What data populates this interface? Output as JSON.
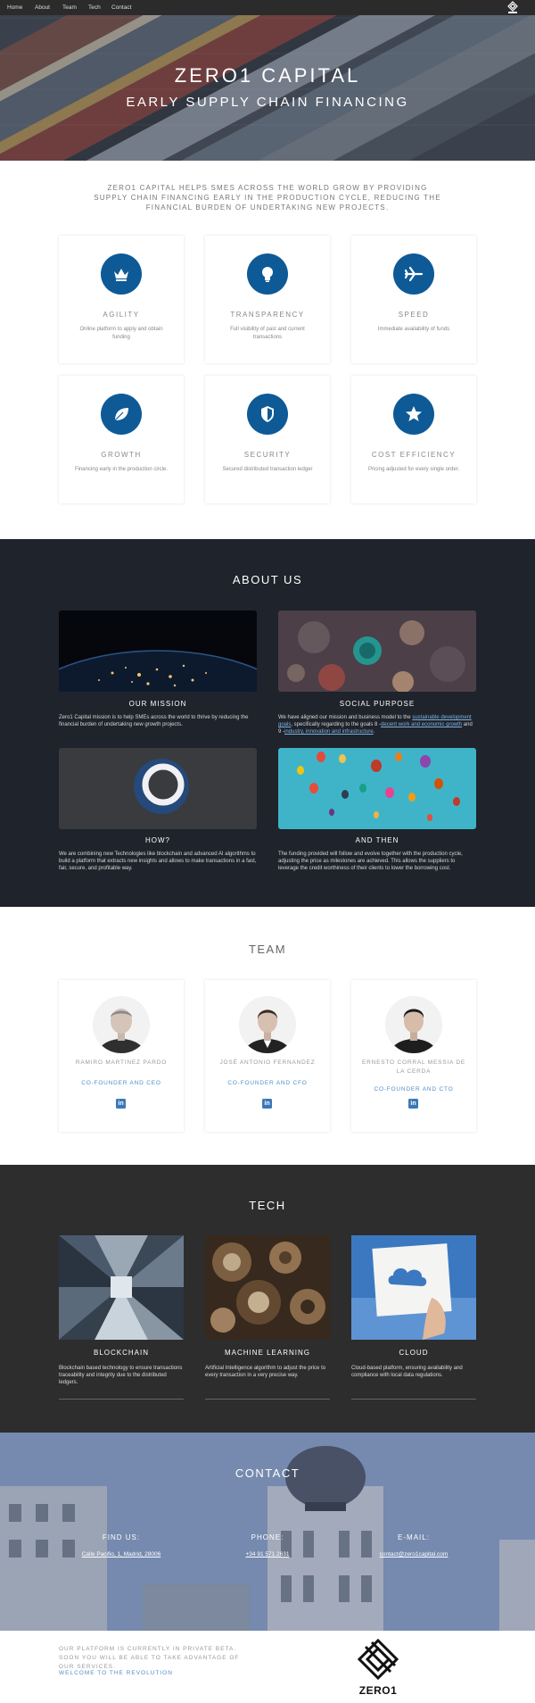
{
  "nav": {
    "links": [
      "Home",
      "About",
      "Team",
      "Tech",
      "Contact"
    ]
  },
  "hero": {
    "title": "ZERO1 CAPITAL",
    "subtitle": "EARLY SUPPLY CHAIN FINANCING"
  },
  "intro": "ZERO1 CAPITAL HELPS SMES ACROSS THE WORLD GROW BY PROVIDING SUPPLY CHAIN FINANCING EARLY IN THE PRODUCTION CYCLE, REDUCING THE FINANCIAL BURDEN OF UNDERTAKING NEW PROJECTS.",
  "features": [
    {
      "icon": "crown-icon",
      "title": "AGILITY",
      "desc": "Online platform to apply and obtain funding"
    },
    {
      "icon": "lightbulb-icon",
      "title": "TRANSPARENCY",
      "desc": "Full visibility of past and current transactions"
    },
    {
      "icon": "airplane-icon",
      "title": "SPEED",
      "desc": "Immediate availability of funds"
    },
    {
      "icon": "leaf-icon",
      "title": "GROWTH",
      "desc": "Financing early in the production circle."
    },
    {
      "icon": "shield-icon",
      "title": "SECURITY",
      "desc": "Secured distributed transaction ledger"
    },
    {
      "icon": "star-icon",
      "title": "COST EFFICIENCY",
      "desc": "Pricing adjusted for every single order."
    }
  ],
  "about": {
    "title": "ABOUT US",
    "mission": {
      "title": "OUR MISSION",
      "text": "Zero1 Capital mission is to help SMEs across the world to thrive by reducing the financial burden of undertaking new growth projects."
    },
    "social": {
      "title": "SOCIAL PURPOSE",
      "text1": "We have aligned our mission and business model to the ",
      "link1": "sustainable development goals",
      "text2": ", specifically regarding to the goals 8 -",
      "link2": "decent work and economic growth",
      "text3": " and 9 -",
      "link3": "industry, innovation and infrastructure",
      "text4": "."
    },
    "how": {
      "title": "HOW?",
      "text": "We are combining new Technologies like blockchain and advanced AI algorithms to build a platform that extracts new insights and allows to make transactions in a fast, fair, secure, and profitable way."
    },
    "then": {
      "title": "AND THEN",
      "text": "The funding provided will follow and evolve together with the production cycle, adjusting the price as milestones are achieved. This allows the suppliers to leverage the credit worthiness of their clients to lower the borrowing cost."
    }
  },
  "team": {
    "title": "TEAM",
    "members": [
      {
        "name": "RAMIRO MARTINEZ PARDO",
        "role": "CO-FOUNDER AND CEO"
      },
      {
        "name": "JOSÉ ANTONIO FERNANDEZ",
        "role": "CO-FOUNDER AND CFO"
      },
      {
        "name": "ERNESTO CORRAL MESSIA DE LA CERDA",
        "role": "CO-FOUNDER AND CTO"
      }
    ],
    "linkedin_label": "in"
  },
  "tech": {
    "title": "TECH",
    "items": [
      {
        "title": "BLOCKCHAIN",
        "text": "Blockchain based technology to ensure transactions traceability and integrity due to the distributed ledgers."
      },
      {
        "title": "MACHINE LEARNING",
        "text": "Artificial Intelligence algorithm to adjust the price to every transaction in a very precise way."
      },
      {
        "title": "CLOUD",
        "text": "Cloud-based platform, ensuring availability and compliance with local data regulations."
      }
    ]
  },
  "contact": {
    "title": "CONTACT",
    "find_label": "FIND US:",
    "find_value": "Calle Pacifio, 1, Madrid, 28006",
    "phone_label": "PHONE:",
    "phone_value": "+34 91 571 2631",
    "email_label": "E-MAIL:",
    "email_value": "contact@zero1capital.com"
  },
  "footer": {
    "text": "OUR PLATFORM IS CURRENTLY IN PRIVATE BETA. SOON YOU WILL BE ABLE TO TAKE ADVANTAGE OF OUR SERVICES.",
    "link": "WELCOME TO THE REVOLUTION",
    "logo_text": "ZERO1"
  },
  "colors": {
    "accent": "#0e5a96",
    "dark": "#1f232b",
    "tech_bg": "#2d2d2d",
    "link": "#4e8fc9"
  }
}
